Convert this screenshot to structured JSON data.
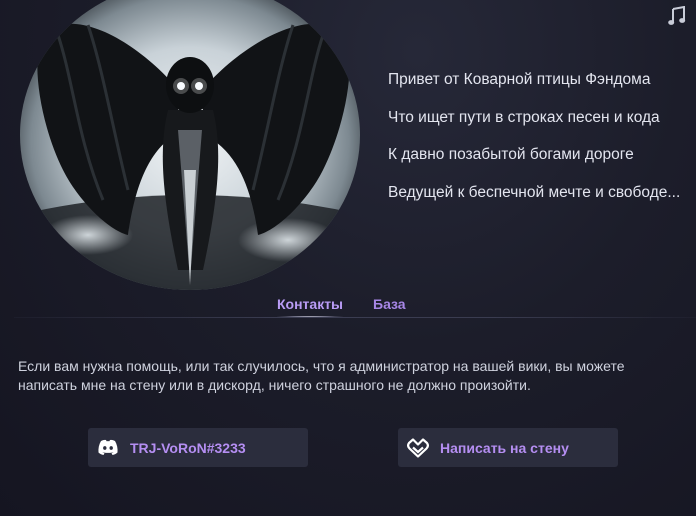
{
  "hero": {
    "art_icon": "dark-winged-creature-art"
  },
  "header": {
    "music_icon": "music-note-icon"
  },
  "poem": {
    "lines": [
      "Привет от Коварной птицы Фэндома",
      "Что ищет пути в строках песен и кода",
      "К давно позабытой богами дороге",
      "Ведущей к беспечной мечте и свободе..."
    ]
  },
  "tabs": [
    {
      "label": "Контакты",
      "active": true
    },
    {
      "label": "База",
      "active": false
    }
  ],
  "contacts": {
    "info_text": "Если вам нужна помощь, или так случилось, что я администратор на вашей вики, вы можете написать мне на стену или в дискорд, ничего страшного не должно произойти.",
    "discord_label": "TRJ-VoRoN#3233",
    "discord_icon": "discord-icon",
    "wall_label": "Написать на стену",
    "wall_icon": "fandom-heart-icon"
  },
  "colors": {
    "background": "#1c1d2a",
    "accent": "#b58ef2",
    "button_bg": "#2b2d3d",
    "text": "#e3e5ef"
  }
}
